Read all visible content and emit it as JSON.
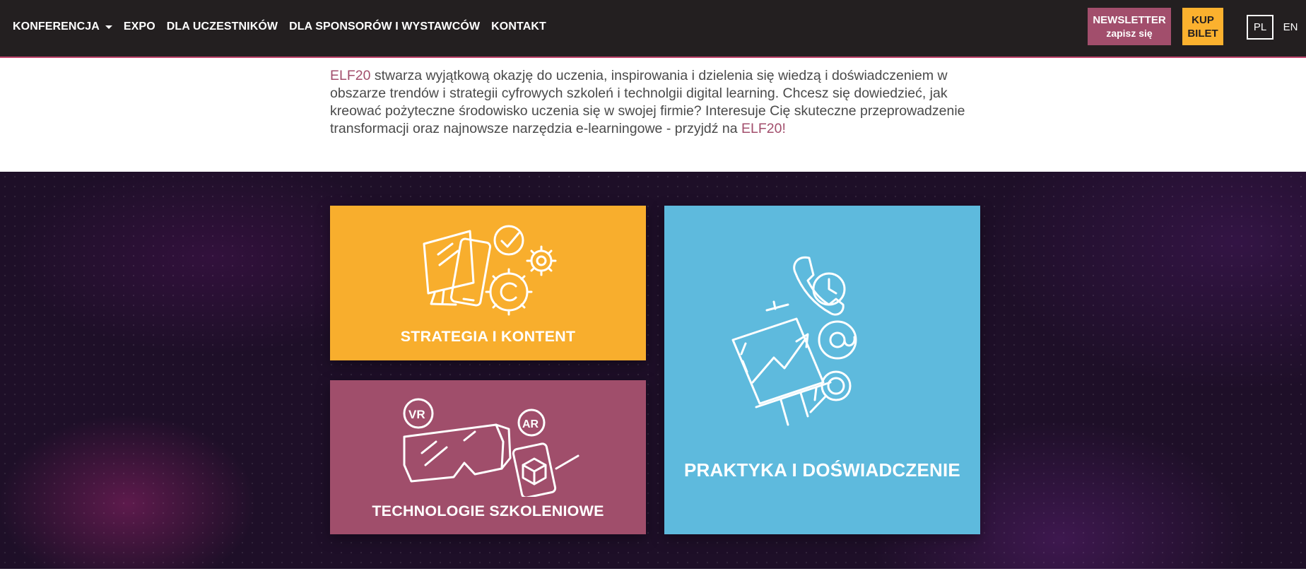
{
  "nav": {
    "items": [
      {
        "label": "KONFERENCJA",
        "has_dropdown": true
      },
      {
        "label": "EXPO",
        "has_dropdown": false
      },
      {
        "label": "DLA UCZESTNIKÓW",
        "has_dropdown": false
      },
      {
        "label": "DLA SPONSORÓW I WYSTAWCÓW",
        "has_dropdown": false
      },
      {
        "label": "KONTAKT",
        "has_dropdown": false
      }
    ],
    "newsletter": {
      "line1": "NEWSLETTER",
      "line2": "zapisz się"
    },
    "ticket": {
      "line1": "KUP",
      "line2": "BILET"
    },
    "lang": {
      "pl": "PL",
      "en": "EN",
      "active": "PL"
    }
  },
  "intro": {
    "brand_start": "ELF20",
    "body": " stwarza wyjątkową okazję do uczenia, inspirowania i dzielenia się wiedzą i doświadczeniem w obszarze trendów i strategii cyfrowych szkoleń i technolgii digital learning. Chcesz się dowiedzieć, jak kreować pożyteczne środowisko uczenia się w swojej firmie? Interesuje Cię skuteczne przeprowadzenie transformacji oraz najnowsze narzędzia e-learningowe - przyjdź na ",
    "brand_end": "ELF20!"
  },
  "tiles": [
    {
      "label": "STRATEGIA I KONTENT",
      "color": "#f8ae2d",
      "icon": "devices-gears-icon"
    },
    {
      "label": "TECHNOLOGIE SZKOLENIOWE",
      "color": "#a04e6b",
      "icon": "vr-ar-icon"
    },
    {
      "label": "PRAKTYKA I DOŚWIADCZENIE",
      "color": "#5ebadd",
      "icon": "presentation-chart-icon"
    }
  ],
  "colors": {
    "nav_bg": "#231f20",
    "accent": "#a24e6c",
    "ticket_bg": "#fbb12e",
    "dark_bg": "#1e0f28"
  }
}
